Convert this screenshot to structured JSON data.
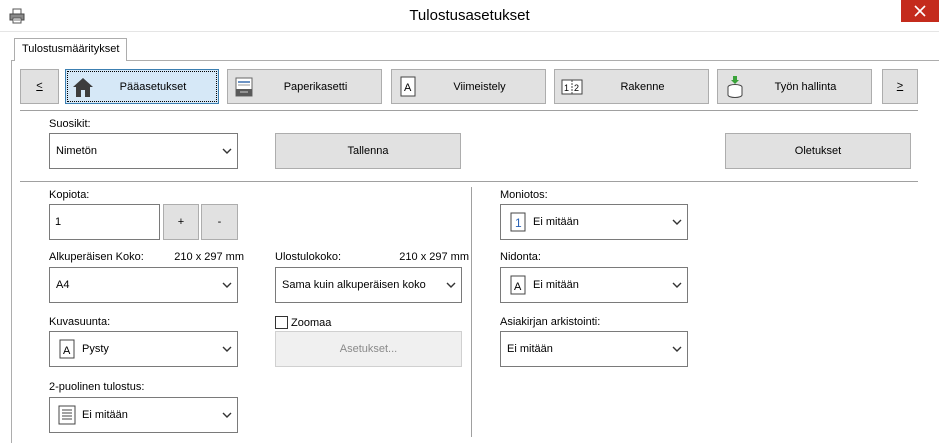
{
  "window": {
    "title": "Tulostusasetukset"
  },
  "tabs": [
    {
      "label": "Tulostusmääritykset"
    }
  ],
  "nav": {
    "prev_label": "<",
    "next_label": ">",
    "items": [
      {
        "label": "Pääasetukset",
        "icon": "home-icon",
        "active": true
      },
      {
        "label": "Paperikasetti",
        "icon": "paper-tray-icon",
        "active": false
      },
      {
        "label": "Viimeistely",
        "icon": "document-a-icon",
        "active": false
      },
      {
        "label": "Rakenne",
        "icon": "layout-icon",
        "active": false
      },
      {
        "label": "Työn hallinta",
        "icon": "job-stack-icon",
        "active": false
      }
    ]
  },
  "favorites": {
    "label": "Suosikit:",
    "value": "Nimetön",
    "save_label": "Tallenna",
    "defaults_label": "Oletukset"
  },
  "copies": {
    "label": "Kopiota:",
    "value": "1",
    "plus_label": "+",
    "minus_label": "-"
  },
  "original_size": {
    "label": "Alkuperäisen Koko:",
    "dimension": "210 x 297 mm",
    "value": "A4"
  },
  "output_size": {
    "label": "Ulostulokoko:",
    "dimension": "210 x 297 mm",
    "value": "Sama kuin alkuperäisen koko"
  },
  "orientation": {
    "label": "Kuvasuunta:",
    "value": "Pysty"
  },
  "zoom": {
    "label": "Zoomaa",
    "checked": false,
    "settings_label": "Asetukset..."
  },
  "duplex": {
    "label": "2-puolinen tulostus:",
    "value": "Ei mitään"
  },
  "multipage": {
    "label": "Moniotos:",
    "value": "Ei mitään"
  },
  "binding": {
    "label": "Nidonta:",
    "value": "Ei mitään"
  },
  "archiving": {
    "label": "Asiakirjan arkistointi:",
    "value": "Ei mitään"
  },
  "colors": {
    "close_red": "#c42b1c",
    "active_tab_bg": "#d6e8f7",
    "active_tab_border": "#3c7fb1",
    "button_bg": "#e1e1e1"
  }
}
